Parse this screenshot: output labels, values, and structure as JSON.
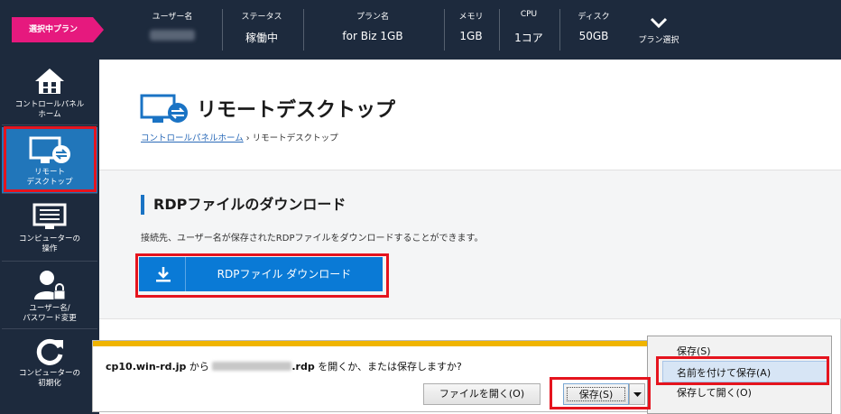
{
  "topbar": {
    "badge": "選択中プラン",
    "columns": [
      {
        "label": "ユーザー名",
        "value": "（非表示）",
        "blurred": true
      },
      {
        "label": "ステータス",
        "value": "稼働中"
      },
      {
        "label": "プラン名",
        "value": "for Biz 1GB"
      },
      {
        "label": "メモリ",
        "value": "1GB"
      },
      {
        "label": "CPU",
        "value": "1コア"
      },
      {
        "label": "ディスク",
        "value": "50GB"
      }
    ],
    "plan_select": "プラン選択"
  },
  "sidebar": {
    "items": [
      {
        "label": "コントロールパネル\nホーム",
        "icon": "home-icon"
      },
      {
        "label": "リモート\nデスクトップ",
        "icon": "remote-desktop-icon",
        "active": true
      },
      {
        "label": "コンピューターの\n操作",
        "icon": "computer-operation-icon"
      },
      {
        "label": "ユーザー名/\nパスワード変更",
        "icon": "user-lock-icon"
      },
      {
        "label": "コンピューターの\n初期化",
        "icon": "reset-icon"
      }
    ]
  },
  "main": {
    "title": "リモートデスクトップ",
    "breadcrumb_link": "コントロールパネルホーム",
    "breadcrumb_sep": " › ",
    "breadcrumb_current": "リモートデスクトップ",
    "section_title": "RDPファイルのダウンロード",
    "section_desc": "接続先、ユーザー名が保存されたRDPファイルをダウンロードすることができます。",
    "download_button": "RDPファイル ダウンロード"
  },
  "notification": {
    "host": "cp10.win-rd.jp",
    "from": " から ",
    "file_ext": ".rdp",
    "question": " を開くか、または保存しますか?",
    "open_button": "ファイルを開く(O)",
    "save_button": "保存(S)"
  },
  "context_menu": {
    "items": [
      "保存(S)",
      "名前を付けて保存(A)",
      "保存して開く(O)"
    ],
    "selected_index": 1
  },
  "colors": {
    "navy": "#1d2a3d",
    "accent_blue": "#0a7ad6",
    "active_blue": "#2176ba",
    "pink": "#e6197e",
    "highlight_red": "#e5141e",
    "notification_stripe": "#f0b400"
  }
}
